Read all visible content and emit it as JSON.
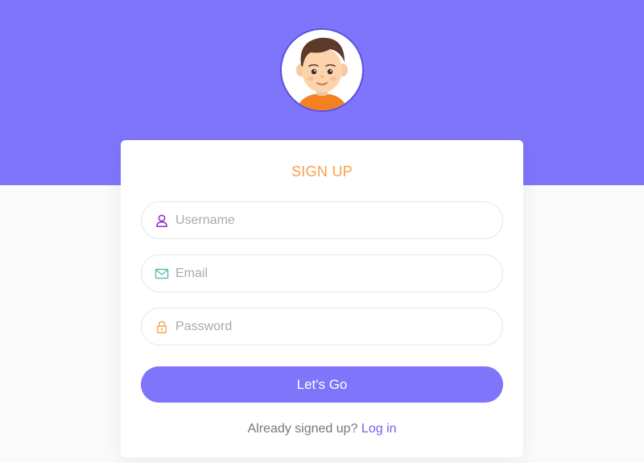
{
  "colors": {
    "header_band": "#7f75fb",
    "page_background": "#fafafa",
    "title": "#f9a04b",
    "button": "#7f75fb",
    "link": "#6f63f0",
    "username_icon": "#8a2fc9",
    "email_icon": "#5bbcb5",
    "password_icon": "#f9a04b"
  },
  "avatar": {
    "icon": "boy-avatar-icon"
  },
  "form": {
    "title": "SIGN UP",
    "username": {
      "placeholder": "Username",
      "value": "",
      "icon": "user-icon"
    },
    "email": {
      "placeholder": "Email",
      "value": "",
      "icon": "envelope-icon"
    },
    "password": {
      "placeholder": "Password",
      "value": "",
      "icon": "lock-icon"
    },
    "submit_label": "Let's Go",
    "footer": {
      "prompt": "Already signed up?",
      "link_label": "Log in"
    }
  }
}
